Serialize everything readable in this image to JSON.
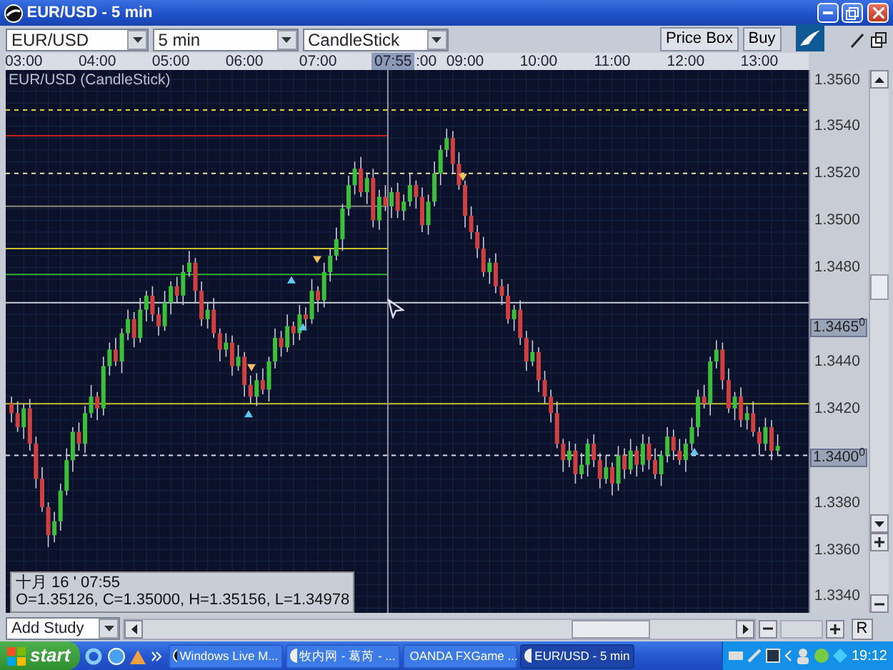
{
  "window": {
    "title": "EUR/USD - 5 min"
  },
  "toolbar": {
    "instrument": "EUR/USD",
    "interval": "5 min",
    "chart_type": "CandleStick",
    "buttons": [
      "Price Box",
      "Buy"
    ]
  },
  "time_axis": {
    "cursor_time": "07:55",
    "covered_label": ":00"
  },
  "chart": {
    "title": "EUR/USD (CandleStick)",
    "price_markers": [
      "1.3465$^{0}$",
      "1.3400$^{0}$"
    ],
    "chart_data": {
      "type": "candlestick",
      "xlim": [
        165.3,
        820.3
      ],
      "ylim": [
        1.3333,
        1.3564
      ],
      "grid": true,
      "ref_lines": [
        {
          "axis": "y",
          "value": 1.3547,
          "color": "#e0d040"
        },
        {
          "axis": "y",
          "value": 1.3536,
          "color": "#c02020"
        },
        {
          "axis": "y",
          "value": 1.352,
          "color": "#e8e0a0"
        },
        {
          "axis": "y",
          "value": 1.3506,
          "color": "#8a8a7a"
        },
        {
          "axis": "y",
          "value": 1.3488,
          "color": "#c8c030"
        },
        {
          "axis": "y",
          "value": 1.3477,
          "color": "#30b030"
        },
        {
          "axis": "y",
          "value": 1.3465,
          "color": "#c8ccd8"
        },
        {
          "axis": "y",
          "value": 1.3422,
          "color": "#c8c030"
        },
        {
          "axis": "y",
          "value": 1.34,
          "color": "#d8dce8"
        },
        {
          "axis": "x",
          "value": 477,
          "color": "#9098a8"
        }
      ],
      "xticks": [
        {
          "value": 180,
          "label": "03:00"
        },
        {
          "value": 240,
          "label": "04:00"
        },
        {
          "value": 300,
          "label": "05:00"
        },
        {
          "value": 360,
          "label": "06:00"
        },
        {
          "value": 420,
          "label": "07:00"
        },
        {
          "value": 540,
          "label": "09:00"
        },
        {
          "value": 600,
          "label": "10:00"
        },
        {
          "value": 660,
          "label": "11:00"
        },
        {
          "value": 720,
          "label": "12:00"
        },
        {
          "value": 780,
          "label": "13:00"
        }
      ],
      "yticks": [
        {
          "value": 1.356,
          "label": "1.3560"
        },
        {
          "value": 1.354,
          "label": "1.3540"
        },
        {
          "value": 1.352,
          "label": "1.3520"
        },
        {
          "value": 1.35,
          "label": "1.3500"
        },
        {
          "value": 1.348,
          "label": "1.3480"
        },
        {
          "value": 1.344,
          "label": "1.3440"
        },
        {
          "value": 1.342,
          "label": "1.3420"
        },
        {
          "value": 1.338,
          "label": "1.3380"
        },
        {
          "value": 1.336,
          "label": "1.3360"
        },
        {
          "value": 1.334,
          "label": "1.3340"
        }
      ],
      "x": [
        170,
        175,
        180,
        185,
        190,
        195,
        200,
        205,
        210,
        215,
        220,
        225,
        230,
        235,
        240,
        245,
        250,
        255,
        260,
        265,
        270,
        275,
        280,
        285,
        290,
        295,
        300,
        305,
        310,
        315,
        320,
        325,
        330,
        335,
        340,
        345,
        350,
        355,
        360,
        365,
        370,
        375,
        380,
        385,
        390,
        395,
        400,
        405,
        410,
        415,
        420,
        425,
        430,
        435,
        440,
        445,
        450,
        455,
        460,
        465,
        470,
        475,
        480,
        485,
        490,
        495,
        500,
        505,
        510,
        515,
        520,
        525,
        530,
        535,
        540,
        545,
        550,
        555,
        560,
        565,
        570,
        575,
        580,
        585,
        590,
        595,
        600,
        605,
        610,
        615,
        620,
        625,
        630,
        635,
        640,
        645,
        650,
        655,
        660,
        665,
        670,
        675,
        680,
        685,
        690,
        695,
        700,
        705,
        710,
        715,
        720,
        725,
        730,
        735,
        740,
        745,
        750,
        755,
        760,
        765,
        770,
        775,
        780,
        785,
        790,
        795
      ],
      "ohlc": [
        [
          1.3422,
          1.3425,
          1.3414,
          1.3418
        ],
        [
          1.3418,
          1.3423,
          1.341,
          1.3412
        ],
        [
          1.3412,
          1.3422,
          1.3407,
          1.342
        ],
        [
          1.342,
          1.3424,
          1.3402,
          1.3405
        ],
        [
          1.3405,
          1.3408,
          1.3386,
          1.339
        ],
        [
          1.339,
          1.3395,
          1.3376,
          1.3378
        ],
        [
          1.3378,
          1.338,
          1.3361,
          1.3366
        ],
        [
          1.3366,
          1.3376,
          1.3363,
          1.3372
        ],
        [
          1.3372,
          1.3388,
          1.3368,
          1.3385
        ],
        [
          1.3385,
          1.3403,
          1.3383,
          1.3398
        ],
        [
          1.3398,
          1.3412,
          1.3393,
          1.341
        ],
        [
          1.341,
          1.3414,
          1.3402,
          1.3405
        ],
        [
          1.3405,
          1.3421,
          1.3401,
          1.3418
        ],
        [
          1.3418,
          1.343,
          1.3416,
          1.3425
        ],
        [
          1.3425,
          1.3427,
          1.3415,
          1.342
        ],
        [
          1.342,
          1.3442,
          1.3417,
          1.3438
        ],
        [
          1.3438,
          1.3448,
          1.3434,
          1.3445
        ],
        [
          1.3445,
          1.345,
          1.3438,
          1.344
        ],
        [
          1.344,
          1.3454,
          1.3435,
          1.3452
        ],
        [
          1.3452,
          1.3462,
          1.3449,
          1.3458
        ],
        [
          1.3458,
          1.3461,
          1.3446,
          1.345
        ],
        [
          1.345,
          1.3467,
          1.3448,
          1.3462
        ],
        [
          1.3462,
          1.347,
          1.3457,
          1.3468
        ],
        [
          1.3468,
          1.3472,
          1.3457,
          1.346
        ],
        [
          1.346,
          1.3463,
          1.3451,
          1.3455
        ],
        [
          1.3455,
          1.347,
          1.3453,
          1.3465
        ],
        [
          1.3465,
          1.3474,
          1.346,
          1.3472
        ],
        [
          1.3472,
          1.3476,
          1.3465,
          1.3468
        ],
        [
          1.3468,
          1.3481,
          1.3464,
          1.3478
        ],
        [
          1.3478,
          1.3487,
          1.3476,
          1.3482
        ],
        [
          1.3482,
          1.3484,
          1.3465,
          1.347
        ],
        [
          1.347,
          1.3474,
          1.3455,
          1.3458
        ],
        [
          1.3458,
          1.3465,
          1.3454,
          1.3462
        ],
        [
          1.3462,
          1.3467,
          1.345,
          1.3452
        ],
        [
          1.3452,
          1.3454,
          1.344,
          1.3445
        ],
        [
          1.3445,
          1.3452,
          1.3442,
          1.3448
        ],
        [
          1.3448,
          1.3451,
          1.3434,
          1.3438
        ],
        [
          1.3438,
          1.3447,
          1.3436,
          1.3442
        ],
        [
          1.3442,
          1.3444,
          1.3425,
          1.343
        ],
        [
          1.343,
          1.3434,
          1.3422,
          1.3425
        ],
        [
          1.3425,
          1.3435,
          1.3421,
          1.3432
        ],
        [
          1.3432,
          1.3437,
          1.3426,
          1.3428
        ],
        [
          1.3428,
          1.3442,
          1.3423,
          1.344
        ],
        [
          1.344,
          1.3454,
          1.3437,
          1.345
        ],
        [
          1.345,
          1.3453,
          1.3442,
          1.3446
        ],
        [
          1.3446,
          1.346,
          1.3444,
          1.3455
        ],
        [
          1.3455,
          1.3457,
          1.3447,
          1.3452
        ],
        [
          1.3452,
          1.3464,
          1.3449,
          1.346
        ],
        [
          1.346,
          1.3463,
          1.3454,
          1.3458
        ],
        [
          1.3458,
          1.3475,
          1.3456,
          1.347
        ],
        [
          1.347,
          1.3472,
          1.3461,
          1.3466
        ],
        [
          1.3466,
          1.3482,
          1.3463,
          1.3478
        ],
        [
          1.3478,
          1.3488,
          1.3474,
          1.3485
        ],
        [
          1.3485,
          1.3497,
          1.3483,
          1.3492
        ],
        [
          1.3492,
          1.3507,
          1.3487,
          1.3505
        ],
        [
          1.3505,
          1.3519,
          1.3502,
          1.3515
        ],
        [
          1.3515,
          1.3525,
          1.3511,
          1.3522
        ],
        [
          1.3522,
          1.3527,
          1.351,
          1.3512
        ],
        [
          1.3512,
          1.352,
          1.3507,
          1.3518
        ],
        [
          1.3518,
          1.3522,
          1.3497,
          1.35
        ],
        [
          1.35,
          1.3513,
          1.3496,
          1.351
        ],
        [
          1.351,
          1.3515,
          1.3504,
          1.3506
        ],
        [
          1.3506,
          1.3514,
          1.3501,
          1.3512
        ],
        [
          1.3512,
          1.3516,
          1.3501,
          1.3504
        ],
        [
          1.3504,
          1.3511,
          1.35,
          1.3508
        ],
        [
          1.3508,
          1.352,
          1.3506,
          1.3515
        ],
        [
          1.3515,
          1.3517,
          1.3505,
          1.351
        ],
        [
          1.351,
          1.3514,
          1.3495,
          1.3498
        ],
        [
          1.3498,
          1.3511,
          1.3494,
          1.3508
        ],
        [
          1.3508,
          1.3525,
          1.3506,
          1.352
        ],
        [
          1.352,
          1.3532,
          1.3515,
          1.353
        ],
        [
          1.353,
          1.3539,
          1.3527,
          1.3535
        ],
        [
          1.3535,
          1.3538,
          1.352,
          1.3524
        ],
        [
          1.3524,
          1.3529,
          1.3513,
          1.3515
        ],
        [
          1.3515,
          1.3517,
          1.3497,
          1.3502
        ],
        [
          1.3502,
          1.3506,
          1.3492,
          1.3495
        ],
        [
          1.3495,
          1.3498,
          1.3484,
          1.3488
        ],
        [
          1.3488,
          1.3493,
          1.3476,
          1.3478
        ],
        [
          1.3478,
          1.3484,
          1.3473,
          1.3482
        ],
        [
          1.3482,
          1.3486,
          1.3469,
          1.3472
        ],
        [
          1.3472,
          1.3475,
          1.3464,
          1.3468
        ],
        [
          1.3468,
          1.3473,
          1.3456,
          1.3458
        ],
        [
          1.3458,
          1.3464,
          1.3453,
          1.3462
        ],
        [
          1.3462,
          1.3466,
          1.3447,
          1.345
        ],
        [
          1.345,
          1.3453,
          1.3436,
          1.344
        ],
        [
          1.344,
          1.3449,
          1.3438,
          1.3444
        ],
        [
          1.3444,
          1.3446,
          1.3427,
          1.3432
        ],
        [
          1.3432,
          1.3436,
          1.3422,
          1.3425
        ],
        [
          1.3425,
          1.3428,
          1.3414,
          1.3418
        ],
        [
          1.3418,
          1.3423,
          1.3403,
          1.3405
        ],
        [
          1.3405,
          1.3407,
          1.3393,
          1.3398
        ],
        [
          1.3398,
          1.3406,
          1.3395,
          1.3402
        ],
        [
          1.3402,
          1.3405,
          1.3388,
          1.3392
        ],
        [
          1.3392,
          1.3401,
          1.339,
          1.3396
        ],
        [
          1.3396,
          1.3407,
          1.3391,
          1.3405
        ],
        [
          1.3405,
          1.3409,
          1.3395,
          1.3398
        ],
        [
          1.3398,
          1.3401,
          1.3386,
          1.339
        ],
        [
          1.339,
          1.34,
          1.3388,
          1.3395
        ],
        [
          1.3395,
          1.3397,
          1.3383,
          1.3388
        ],
        [
          1.3388,
          1.3404,
          1.3385,
          1.34
        ],
        [
          1.34,
          1.3403,
          1.339,
          1.3394
        ],
        [
          1.3394,
          1.3407,
          1.3392,
          1.3402
        ],
        [
          1.3402,
          1.3404,
          1.3391,
          1.3396
        ],
        [
          1.3396,
          1.3409,
          1.3393,
          1.3405
        ],
        [
          1.3405,
          1.3408,
          1.3394,
          1.3398
        ],
        [
          1.3398,
          1.3403,
          1.339,
          1.3392
        ],
        [
          1.3392,
          1.3402,
          1.3387,
          1.34
        ],
        [
          1.34,
          1.3412,
          1.3397,
          1.3408
        ],
        [
          1.3408,
          1.3411,
          1.3398,
          1.3402
        ],
        [
          1.3402,
          1.3407,
          1.3396,
          1.3398
        ],
        [
          1.3398,
          1.3407,
          1.3393,
          1.3405
        ],
        [
          1.3405,
          1.3416,
          1.3402,
          1.3412
        ],
        [
          1.3412,
          1.3428,
          1.3408,
          1.3425
        ],
        [
          1.3425,
          1.343,
          1.342,
          1.3422
        ],
        [
          1.3422,
          1.3442,
          1.3417,
          1.344
        ],
        [
          1.344,
          1.3449,
          1.3437,
          1.3445
        ],
        [
          1.3445,
          1.3448,
          1.3428,
          1.3432
        ],
        [
          1.3432,
          1.3437,
          1.3418,
          1.342
        ],
        [
          1.342,
          1.3427,
          1.3415,
          1.3425
        ],
        [
          1.3425,
          1.3429,
          1.3412,
          1.3415
        ],
        [
          1.3415,
          1.3421,
          1.3411,
          1.3418
        ],
        [
          1.3418,
          1.3423,
          1.3408,
          1.341
        ],
        [
          1.341,
          1.3412,
          1.34,
          1.3405
        ],
        [
          1.3405,
          1.3416,
          1.3402,
          1.3412
        ],
        [
          1.3412,
          1.3415,
          1.3398,
          1.3402
        ],
        [
          1.3402,
          1.3409,
          1.34,
          1.3404
        ]
      ]
    },
    "info": {
      "date": "十月 16 ' 07:55",
      "ohlc": "O=1.35126, C=1.35000, H=1.35156, L=1.34978"
    }
  },
  "bottom_bar": {
    "study": "Add Study",
    "reset": "R"
  },
  "taskbar": {
    "start": "start",
    "tasks": [
      {
        "label": "Windows Live M...",
        "selected": false
      },
      {
        "label": "牧内网 - 葛芮 - ...",
        "selected": false
      },
      {
        "label": "OANDA FXGame ...",
        "selected": false
      },
      {
        "label": "EUR/USD - 5 min",
        "selected": true
      }
    ],
    "clock": "19:12"
  }
}
